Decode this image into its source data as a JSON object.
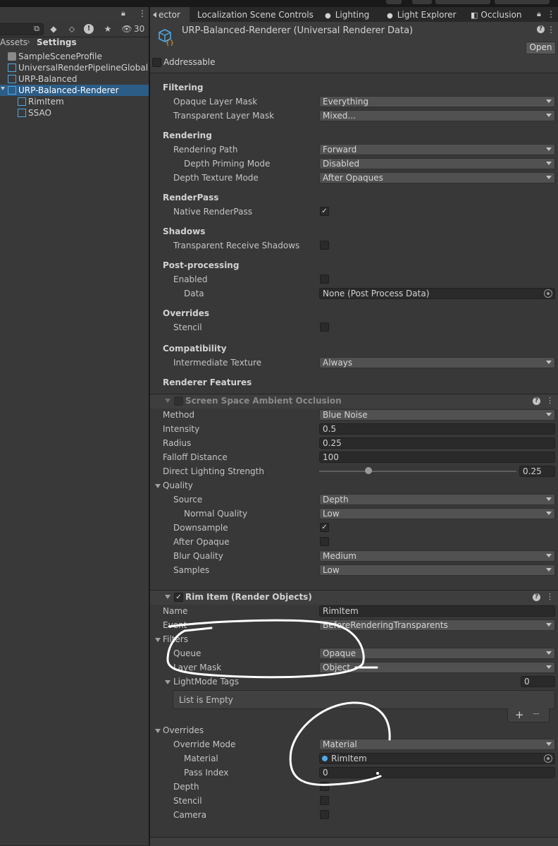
{
  "project": {
    "search_count": "30",
    "breadcrumb": [
      "Assets",
      "Settings"
    ],
    "items": [
      {
        "label": "SampleSceneProfile"
      },
      {
        "label": "UniversalRenderPipelineGlobalS"
      },
      {
        "label": "URP-Balanced"
      },
      {
        "label": "URP-Balanced-Renderer"
      },
      {
        "label": "RimItem"
      },
      {
        "label": "SSAO"
      }
    ]
  },
  "tabs": [
    {
      "label": "ector"
    },
    {
      "label": "Localization Scene Controls"
    },
    {
      "label": "Lighting"
    },
    {
      "label": "Light Explorer"
    },
    {
      "label": "Occlusion"
    }
  ],
  "header": {
    "title": "URP-Balanced-Renderer (Universal Renderer Data)",
    "open_label": "Open",
    "addressable_label": "Addressable"
  },
  "filtering": {
    "title": "Filtering",
    "opaque_layer_mask": {
      "label": "Opaque Layer Mask",
      "value": "Everything"
    },
    "transparent_layer_mask": {
      "label": "Transparent Layer Mask",
      "value": "Mixed..."
    }
  },
  "rendering": {
    "title": "Rendering",
    "rendering_path": {
      "label": "Rendering Path",
      "value": "Forward"
    },
    "depth_priming_mode": {
      "label": "Depth Priming Mode",
      "value": "Disabled"
    },
    "depth_texture_mode": {
      "label": "Depth Texture Mode",
      "value": "After Opaques"
    }
  },
  "renderpass": {
    "title": "RenderPass",
    "native_renderpass": {
      "label": "Native RenderPass",
      "checked": true
    }
  },
  "shadows": {
    "title": "Shadows",
    "transparent_receive_shadows": {
      "label": "Transparent Receive Shadows",
      "checked": false
    }
  },
  "post_processing": {
    "title": "Post-processing",
    "enabled": {
      "label": "Enabled",
      "checked": false
    },
    "data": {
      "label": "Data",
      "value": "None (Post Process Data)"
    }
  },
  "overrides": {
    "title": "Overrides",
    "stencil": {
      "label": "Stencil",
      "checked": false
    }
  },
  "compatibility": {
    "title": "Compatibility",
    "intermediate_texture": {
      "label": "Intermediate Texture",
      "value": "Always"
    }
  },
  "renderer_features": {
    "title": "Renderer Features"
  },
  "ssao": {
    "title": "Screen Space Ambient Occlusion",
    "method": {
      "label": "Method",
      "value": "Blue Noise"
    },
    "intensity": {
      "label": "Intensity",
      "value": "0.5"
    },
    "radius": {
      "label": "Radius",
      "value": "0.25"
    },
    "falloff_distance": {
      "label": "Falloff Distance",
      "value": "100"
    },
    "direct_lighting_strength": {
      "label": "Direct Lighting Strength",
      "value": "0.25",
      "level": 0.25
    },
    "quality_title": "Quality",
    "source": {
      "label": "Source",
      "value": "Depth"
    },
    "normal_quality": {
      "label": "Normal Quality",
      "value": "Low"
    },
    "downsample": {
      "label": "Downsample",
      "checked": true
    },
    "after_opaque": {
      "label": "After Opaque",
      "checked": false
    },
    "blur_quality": {
      "label": "Blur Quality",
      "value": "Medium"
    },
    "samples": {
      "label": "Samples",
      "value": "Low"
    }
  },
  "rim_item": {
    "title": "Rim Item (Render Objects)",
    "name": {
      "label": "Name",
      "value": "RimItem"
    },
    "event": {
      "label": "Event",
      "value": "BeforeRenderingTransparents"
    },
    "filters_title": "Filters",
    "queue": {
      "label": "Queue",
      "value": "Opaque"
    },
    "layer_mask": {
      "label": "Layer Mask",
      "value": "Object"
    },
    "lightmode_tags": {
      "label": "LightMode Tags",
      "value": "0"
    },
    "list_empty": "List is Empty",
    "add_symbol": "+",
    "remove_symbol": "−",
    "overrides_title": "Overrides",
    "override_mode": {
      "label": "Override Mode",
      "value": "Material"
    },
    "material": {
      "label": "Material",
      "value": "RimItem"
    },
    "pass_index": {
      "label": "Pass Index",
      "value": "0"
    },
    "depth": {
      "label": "Depth",
      "checked": false
    },
    "stencil": {
      "label": "Stencil",
      "checked": false
    },
    "camera": {
      "label": "Camera",
      "checked": false
    }
  },
  "colors": {
    "selection": "#2c5d87",
    "accent_icon": "#4fa9e6"
  }
}
